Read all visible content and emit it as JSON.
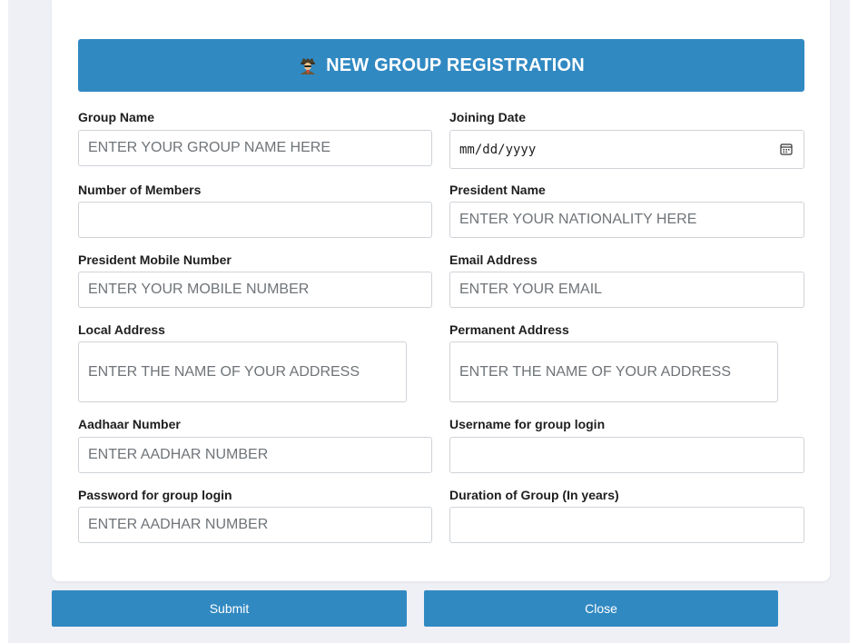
{
  "header": {
    "title": "NEW GROUP REGISTRATION",
    "icon": "incognito-person-icon"
  },
  "fields": {
    "group_name": {
      "label": "Group Name",
      "placeholder": "ENTER YOUR GROUP NAME HERE",
      "value": ""
    },
    "joining_date": {
      "label": "Joining Date",
      "placeholder": "mm/dd/yyyy",
      "value": ""
    },
    "number_of_members": {
      "label": "Number of Members",
      "placeholder": "",
      "value": ""
    },
    "president_name": {
      "label": "President Name",
      "placeholder": "ENTER YOUR NATIONALITY HERE",
      "value": ""
    },
    "president_mobile": {
      "label": "President Mobile Number",
      "placeholder": "ENTER YOUR MOBILE NUMBER",
      "value": ""
    },
    "email": {
      "label": "Email Address",
      "placeholder": "ENTER YOUR EMAIL",
      "value": ""
    },
    "local_address": {
      "label": "Local Address",
      "placeholder": "ENTER THE NAME OF YOUR ADDRESS",
      "value": ""
    },
    "permanent_address": {
      "label": "Permanent Address",
      "placeholder": "ENTER THE NAME OF YOUR ADDRESS",
      "value": ""
    },
    "aadhaar_number": {
      "label": "Aadhaar Number",
      "placeholder": "ENTER AADHAR NUMBER",
      "value": ""
    },
    "username": {
      "label": "Username for group login",
      "placeholder": "",
      "value": ""
    },
    "password": {
      "label": "Password for group login",
      "placeholder": "ENTER AADHAR NUMBER",
      "value": ""
    },
    "duration": {
      "label": "Duration of Group (In years)",
      "placeholder": "",
      "value": ""
    }
  },
  "buttons": {
    "submit": "Submit",
    "close": "Close"
  },
  "colors": {
    "accent": "#3189c2",
    "page_bg": "#eef0f6",
    "border": "#cfd3d8",
    "placeholder": "#6f7478"
  }
}
